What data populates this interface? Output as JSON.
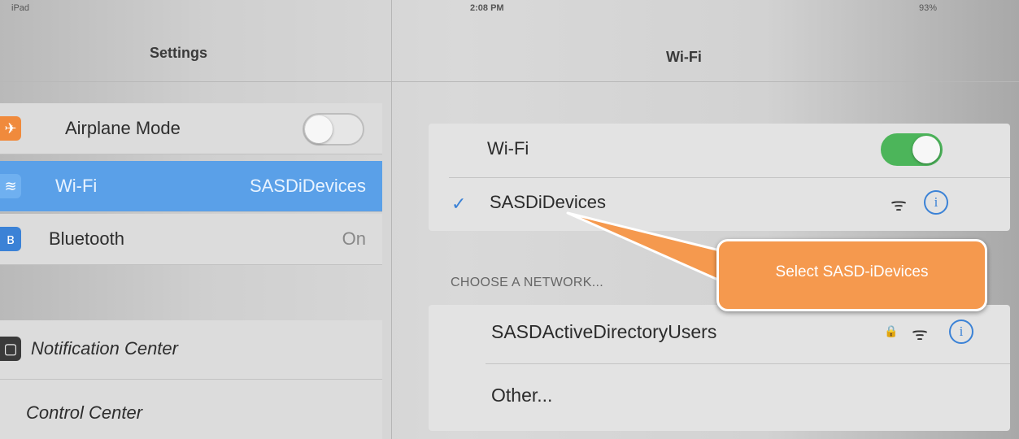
{
  "status_bar": {
    "carrier": "iPad",
    "time": "2:08 PM",
    "battery": "93%"
  },
  "settings": {
    "title": "Settings",
    "items": [
      {
        "label": "Airplane Mode",
        "icon": "airplane-icon",
        "toggle": "off"
      },
      {
        "label": "Wi-Fi",
        "value": "SASDiDevices",
        "icon": "wifi-icon",
        "selected": true
      },
      {
        "label": "Bluetooth",
        "value": "On",
        "icon": "bluetooth-icon"
      },
      {
        "label": "Notification Center",
        "icon": "notification-icon"
      },
      {
        "label": "Control Center",
        "icon": "control-center-icon"
      }
    ]
  },
  "wifi": {
    "title": "Wi-Fi",
    "toggle_label": "Wi-Fi",
    "toggle": "on",
    "connected_network": "SASDiDevices",
    "section_header": "CHOOSE A NETWORK...",
    "networks": [
      {
        "name": "SASDActiveDirectoryUsers",
        "secured": true
      }
    ],
    "other_label": "Other..."
  },
  "callout": {
    "text": "Select SASD-iDevices",
    "color": "#f5994e"
  },
  "colors": {
    "accent": "#3b82d6",
    "selected_row": "#5aa0e8",
    "toggle_on": "#4cb55a"
  }
}
